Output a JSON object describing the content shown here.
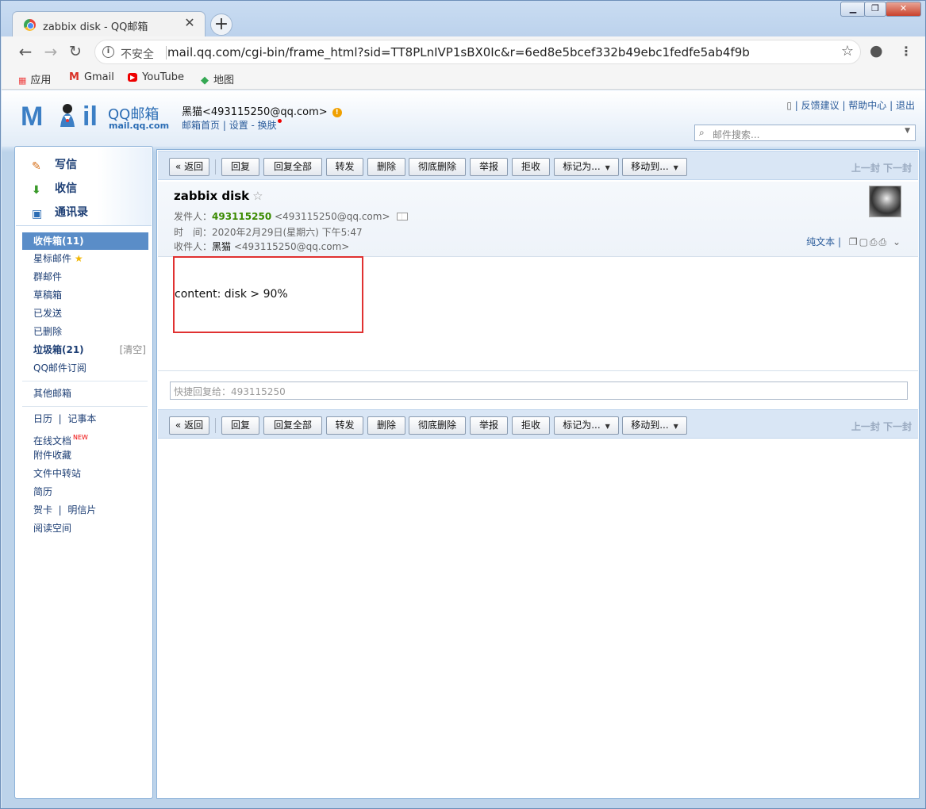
{
  "browser": {
    "tab_title": "zabbix disk - QQ邮箱",
    "not_secure": "不安全",
    "url": "mail.qq.com/cgi-bin/frame_html?sid=TT8PLnIVP1sBX0Ic&r=6ed8e5bcef332b49ebc1fedfe5ab4f9b",
    "bookmarks": [
      "应用",
      "Gmail",
      "YouTube",
      "地图"
    ]
  },
  "header": {
    "logo_qq": "QQ邮箱",
    "logo_domain": "mail.qq.com",
    "account_name": "黑猫<493115250@qq.com>",
    "links": [
      "邮箱首页",
      "设置",
      "换肤"
    ],
    "top_links": [
      "反馈建议",
      "帮助中心",
      "退出"
    ],
    "search_placeholder": "邮件搜索..."
  },
  "sidebar": {
    "quick": [
      "写信",
      "收信",
      "通讯录"
    ],
    "inbox": "收件箱(11)",
    "folders": [
      "星标邮件",
      "群邮件",
      "草稿箱",
      "已发送",
      "已删除"
    ],
    "spam": "垃圾箱(21)",
    "spam_clear": "[清空]",
    "subscribe": "QQ邮件订阅",
    "other": "其他邮箱",
    "calendar": "日历",
    "notes": "记事本",
    "docs": "在线文档",
    "new_badge": "NEW",
    "tools": [
      "附件收藏",
      "文件中转站",
      "简历"
    ],
    "card": "贺卡",
    "postcard": "明信片",
    "reading": "阅读空间"
  },
  "toolbar": {
    "back": "« 返回",
    "reply": "回复",
    "reply_all": "回复全部",
    "forward": "转发",
    "delete": "删除",
    "delete_perm": "彻底删除",
    "report": "举报",
    "reject": "拒收",
    "mark_as": "标记为...",
    "move_to": "移动到...",
    "prev_next": "上一封 下一封"
  },
  "mail": {
    "subject": "zabbix disk",
    "from_label": "发件人：",
    "from_name": "493115250",
    "from_email": "<493115250@qq.com>",
    "time_label": "时　间：",
    "time": "2020年2月29日(星期六) 下午5:47",
    "to_label": "收件人：",
    "to_name": "黑猫",
    "to_email": "<493115250@qq.com>",
    "plain_text": "纯文本",
    "body": "content: disk > 90%",
    "quick_reply_placeholder": "快捷回复给：493115250"
  }
}
